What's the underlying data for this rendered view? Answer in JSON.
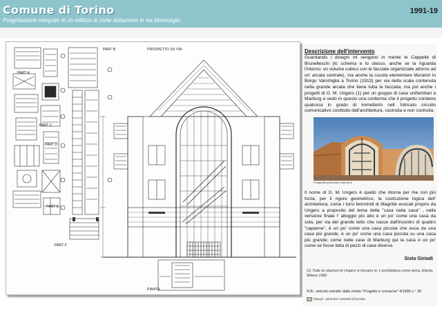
{
  "header": {
    "title": "Comune di Torino",
    "subtitle": "Progettazione integrale di un edificio di civile abitazione in via Monesiglio",
    "year": "1991-19"
  },
  "drawing": {
    "labels": {
      "prospetto": "PROSPETTO SU VIA",
      "part_b": "PART B",
      "part_a": "PART A",
      "part_c": "PART C",
      "part_d": "PART D",
      "part_e": "PART E",
      "part_f": "PART F",
      "pianta": "PIANTA"
    }
  },
  "description": {
    "heading": "Descrizione dell'intervento",
    "paragraph1": "Guardando i disegni mi vengono in mente le Cappelle di Brunelleschi (lo schema e lo stesso, anche se la riguarda l'interno: un volume cubico con le facciate organizzate attorno ad un' arcata centrale), ma anche la scuola elementare Muratori in Borgo Vanchiglia a Torino (1913) per via della scala contenuta nella grande arcata che tiene tutta la facciata, ma poi anche i progetti di O. M. Ungers (1) per un gruppo di case unifamiliari a Marburg e vedo in questo una conferma che il progetto contiene qualcosa in grado di immetterlo nell 'intricato circuito comunicativo costituito dall'architettura, costruita e non costruita.",
    "photo_caption": "Fotografia particolare copertura",
    "paragraph2": "Il nome di O. M. Ungers è quello che ritorna per me con più forza, per il rigore geometrico, la costruzione logica dell' architettura; come i torsi femminili di Magritte evocati proprio da Ungers a proposito del tema della \"casa nella casa\" , nella versione finale l' alloggio più alto è un po' come una casa da sola, per via del grande tetto che nasce dall'incontro di quattro \"capanne\", è un po' come una casa piccola che esca da una casa più grande, è un po' come una casa piccola su una casa più grande; come nelle case di Marburg qui la casa è un po' come se fosse fatta di pezzi di case diverse.",
    "signature": "Sisto Giriodi",
    "footnote": "(1) Tutte le citazioni di Ungers si trovano in: L'architettura come tema, Electa, Milano 1982",
    "nb": "N.B.: articolo estratto dalla rivista \"Progetto e cronache\" 4/1996 n.° 36",
    "legend": "Disegni - particolari costruttivi di facciata"
  },
  "colors": {
    "header_bg": "#8ec5cd",
    "line": "#2a2a2a"
  }
}
